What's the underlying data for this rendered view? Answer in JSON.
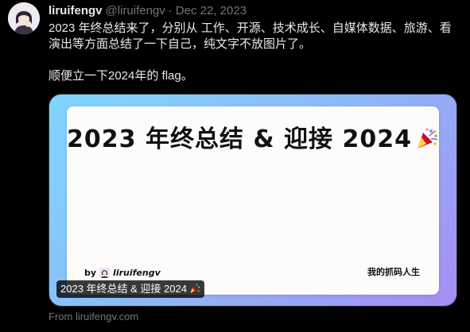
{
  "tweet": {
    "author_name": "liruifengv",
    "author_handle": "@liruifengv",
    "separator": "·",
    "date": "Dec 22, 2023",
    "text_line1": "2023 年终总结来了，分别从 工作、开源、技术成长、自媒体数据、旅游、看",
    "text_line2": "演出等方面总结了一下自己，纯文字不放图片了。",
    "text_line3": "顺便立一下2024年的 flag。"
  },
  "card": {
    "title": "2023 年终总结 & 迎接 2024",
    "by_label": "by",
    "author": "liruifengv",
    "corner_text": "我的抓码人生",
    "label": "2023 年终总结 & 迎接 2024",
    "source": "From liruifengv.com",
    "gradient_colors": [
      "#7fd6ff",
      "#8bbcf7",
      "#a68df5"
    ]
  },
  "icons": {
    "avatar": "user-avatar",
    "title_emoji": "party-popper-icon",
    "label_emoji": "party-popper-icon"
  },
  "colors": {
    "background": "#000000",
    "primary_text": "#e7e9ea",
    "secondary_text": "#71767b"
  }
}
